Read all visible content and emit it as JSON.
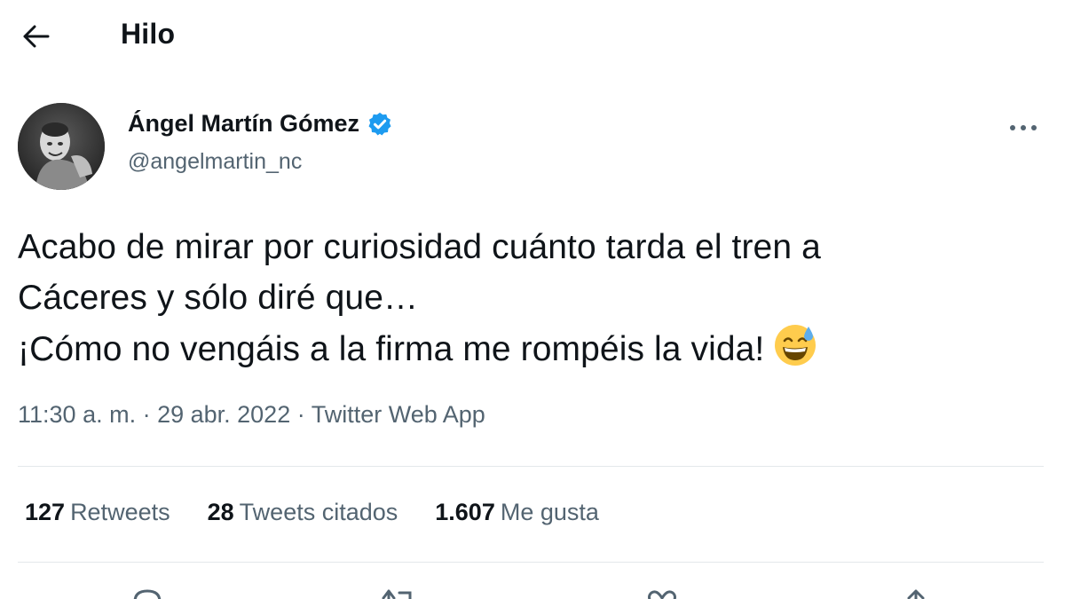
{
  "header": {
    "title": "Hilo",
    "back_icon": "arrow-left-icon"
  },
  "author": {
    "name": "Ángel Martín Gómez",
    "handle": "@angelmartin_nc",
    "verified_icon": "verified-badge-icon",
    "verified_color": "#1d9bf0",
    "more_icon": "more-horizontal-icon"
  },
  "tweet": {
    "text": "Acabo de mirar por curiosidad cuánto tarda el tren a\nCáceres y sólo diré que…\n¡Cómo no vengáis a la firma me rompéis la vida!",
    "emoji_icon": "grinning-sweat-emoji-icon"
  },
  "meta": {
    "time": "11:30 a. m.",
    "separator": " · ",
    "date": "29 abr. 2022",
    "source": "Twitter Web App"
  },
  "stats": {
    "retweets_count": "127",
    "retweets_label": "Retweets",
    "quotes_count": "28",
    "quotes_label": "Tweets citados",
    "likes_count": "1.607",
    "likes_label": "Me gusta"
  },
  "actions": {
    "reply_icon": "reply-icon",
    "retweet_icon": "retweet-icon",
    "like_icon": "heart-icon",
    "share_icon": "share-icon"
  },
  "colors": {
    "text_primary": "#0f1419",
    "text_secondary": "#536471",
    "divider": "#e3e8eb"
  }
}
